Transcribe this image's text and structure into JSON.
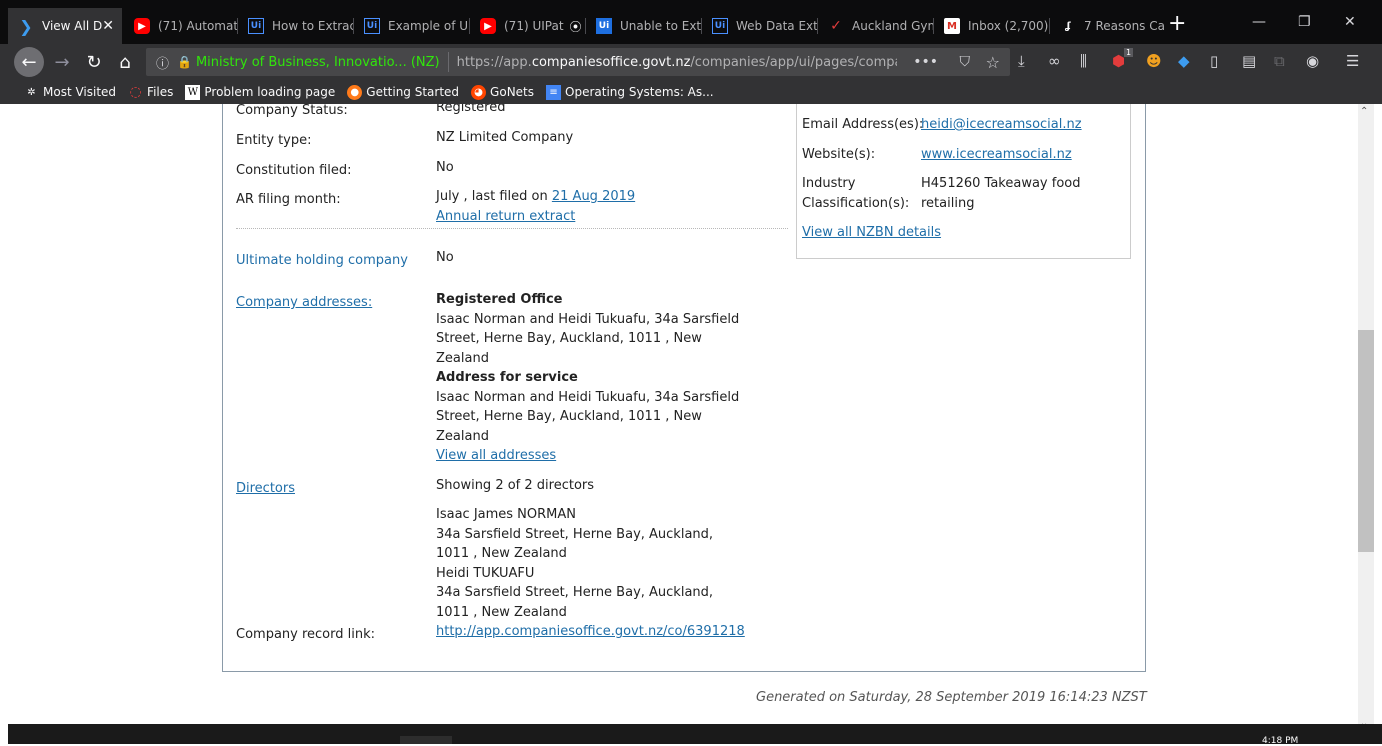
{
  "browser": {
    "tabs": [
      {
        "label": "View All D",
        "icon": "chevron-icon",
        "active": true
      },
      {
        "label": "(71) Automat",
        "icon": "youtube-icon"
      },
      {
        "label": "How to Extrac",
        "icon": "uipath-icon"
      },
      {
        "label": "Example of U",
        "icon": "uipath-icon"
      },
      {
        "label": "(71) UIPat",
        "icon": "youtube-icon"
      },
      {
        "label": "Unable to Ext",
        "icon": "uipath-icon"
      },
      {
        "label": "Web Data Ext",
        "icon": "uipath-icon"
      },
      {
        "label": "Auckland Gym",
        "icon": "tick-icon"
      },
      {
        "label": "Inbox (2,700)",
        "icon": "gmail-icon"
      },
      {
        "label": "7 Reasons Ca",
        "icon": "page-icon"
      }
    ],
    "address": {
      "site_identity": "Ministry of Business, Innovatio... (NZ)",
      "url_prefix": "https://app.",
      "url_domain": "companiesoffice.govt.nz",
      "url_path": "/companies/app/ui/pages/companies/"
    },
    "toolbar_badge": "1",
    "bookmarks": [
      {
        "label": "Most Visited",
        "icon": "gear-icon"
      },
      {
        "label": "Files",
        "icon": "loading-icon"
      },
      {
        "label": "Problem loading page",
        "icon": "wikipedia-icon"
      },
      {
        "label": "Getting Started",
        "icon": "firefox-icon"
      },
      {
        "label": "GoNets",
        "icon": "reddit-icon"
      },
      {
        "label": "Operating Systems: As...",
        "icon": "doc-icon"
      }
    ]
  },
  "company": {
    "status_label": "Company Status:",
    "status_value": "Registered",
    "entity_label": "Entity type:",
    "entity_value": "NZ Limited Company",
    "constitution_label": "Constitution filed:",
    "constitution_value": "No",
    "ar_label": "AR filing month:",
    "ar_value_prefix": "July , last filed on",
    "ar_date": "21 Aug 2019",
    "ar_extract": "Annual return extract",
    "holding_label": "Ultimate holding company",
    "holding_value": "No",
    "addresses_label": "Company addresses:",
    "registered_office_heading": "Registered Office",
    "registered_office_lines": [
      "Isaac Norman and Heidi Tukuafu, 34a Sarsfield",
      "Street, Herne Bay, Auckland, 1011 , New",
      "Zealand"
    ],
    "service_heading": "Address for service",
    "service_lines": [
      "Isaac Norman and Heidi Tukuafu, 34a Sarsfield",
      "Street, Herne Bay, Auckland, 1011 , New",
      "Zealand"
    ],
    "view_addresses": "View all addresses",
    "directors_label": "Directors",
    "directors_count": "Showing 2 of 2 directors",
    "director_lines": [
      "Isaac James NORMAN",
      "34a Sarsfield Street, Herne Bay, Auckland,",
      "1011 , New Zealand",
      "Heidi TUKUAFU",
      "34a Sarsfield Street, Herne Bay, Auckland,",
      "1011 , New Zealand"
    ],
    "record_label": "Company record link:",
    "record_link": "http://app.companiesoffice.govt.nz/co/6391218"
  },
  "nzbn": {
    "email_label": "Email Address(es):",
    "email_value": "heidi@icecreamsocial.nz",
    "website_label": "Website(s):",
    "website_value": "www.icecreamsocial.nz",
    "industry_label_1": "Industry",
    "industry_label_2": "Classification(s):",
    "industry_value_1": "H451260 Takeaway food",
    "industry_value_2": "retailing",
    "view_all": "View all NZBN details"
  },
  "footer": {
    "generated": "Generated on Saturday, 28 September 2019 16:14:23 NZST"
  },
  "taskbar": {
    "clock": "4:18 PM"
  },
  "colors": {
    "link": "#1f6ea8",
    "identity_green": "#30e60b",
    "tab_bar": "#0c0c0d",
    "nav_bar": "#323234"
  }
}
